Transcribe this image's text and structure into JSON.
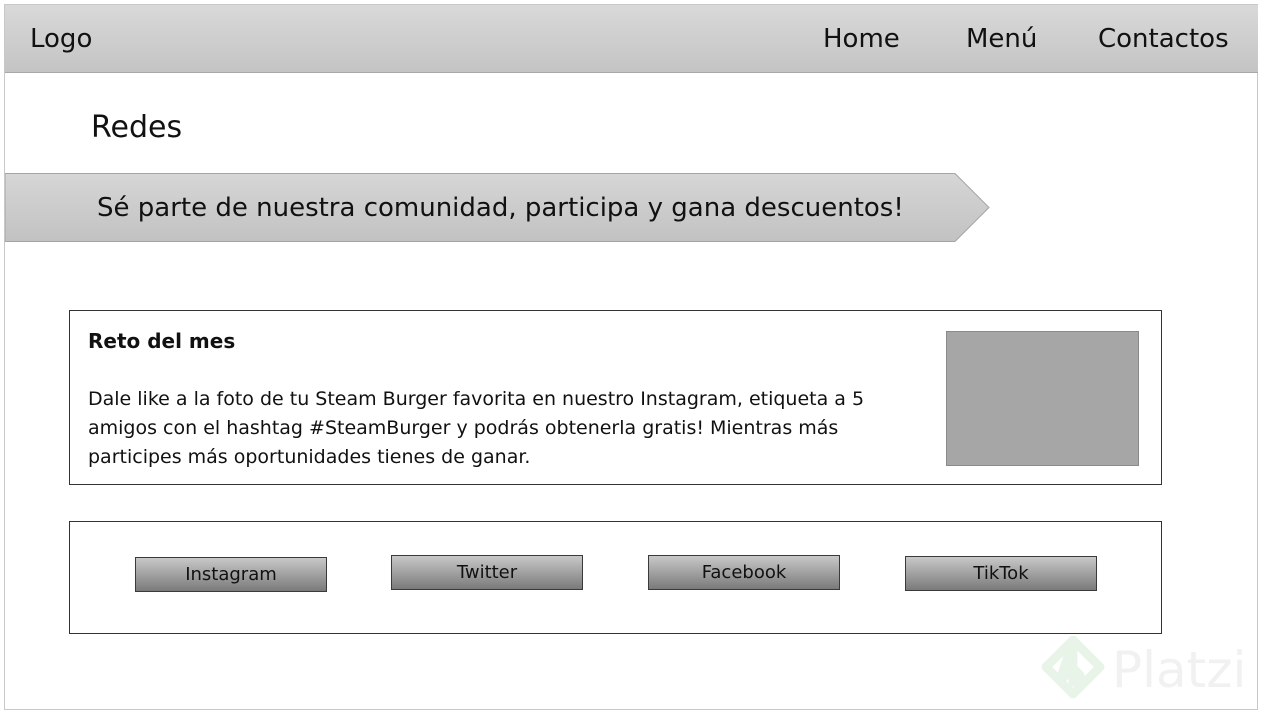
{
  "navbar": {
    "logo": "Logo",
    "items": [
      {
        "label": "Home"
      },
      {
        "label": "Menú"
      },
      {
        "label": "Contactos"
      }
    ]
  },
  "section": {
    "title": "Redes"
  },
  "banner": {
    "text": "Sé parte de nuestra comunidad, participa y gana descuentos!"
  },
  "challenge": {
    "title": "Reto del mes",
    "body": "Dale like a la foto de tu Steam Burger favorita en nuestro Instagram, etiqueta a 5 amigos con el hashtag #SteamBurger y podrás obtenerla gratis! Mientras más participes más oportunidades tienes de ganar."
  },
  "social": {
    "buttons": [
      {
        "label": "Instagram"
      },
      {
        "label": "Twitter"
      },
      {
        "label": "Facebook"
      },
      {
        "label": "TikTok"
      }
    ]
  },
  "watermark": {
    "text": "Platzi"
  },
  "colors": {
    "navbar": "#cfcfcf",
    "banner": "#cccccc",
    "image_placeholder": "#a6a6a6",
    "button": "#8f8f8f"
  }
}
